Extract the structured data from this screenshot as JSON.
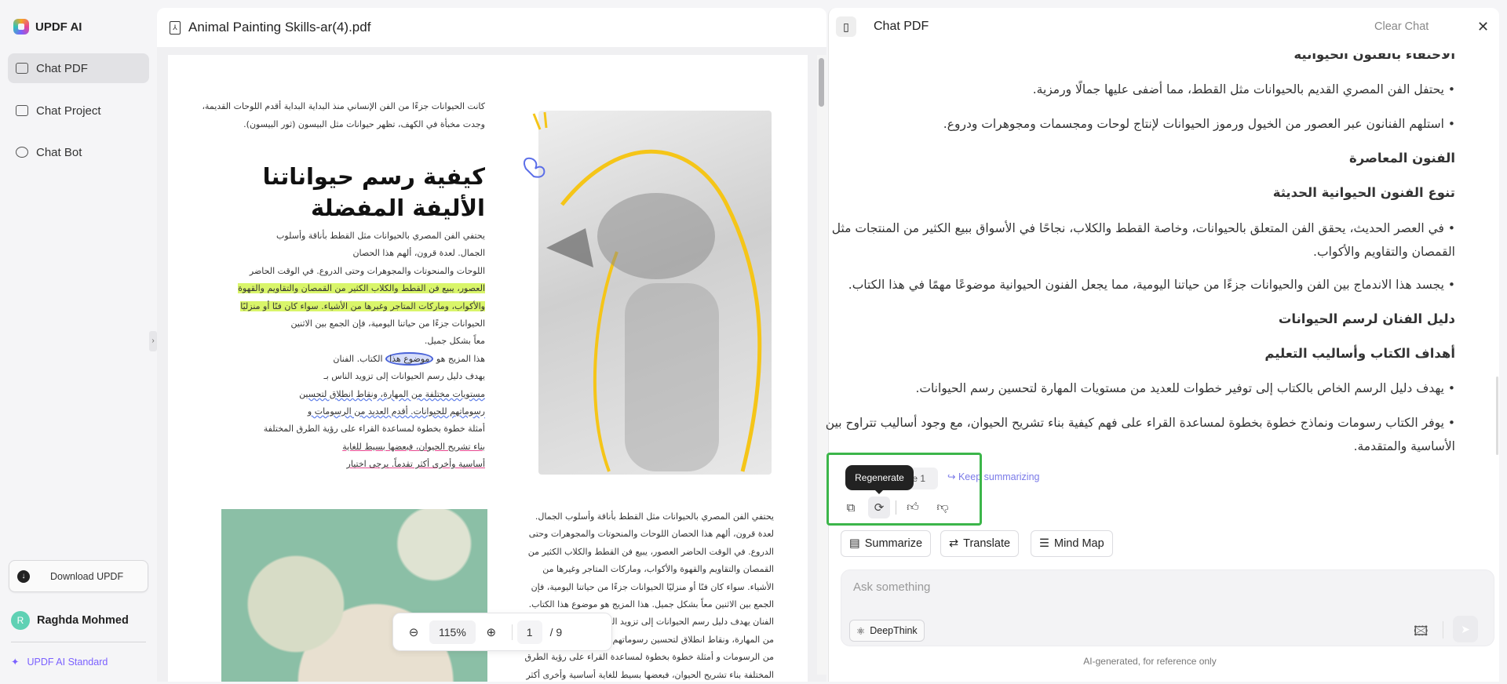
{
  "sidebar": {
    "app_name": "UPDF AI",
    "items": [
      {
        "label": "Chat PDF",
        "active": true
      },
      {
        "label": "Chat Project"
      },
      {
        "label": "Chat Bot"
      }
    ],
    "download_label": "Download UPDF",
    "user": {
      "initial": "R",
      "name": "Raghda Mohmed"
    },
    "plan_label": "UPDF AI Standard"
  },
  "viewer": {
    "file_name": "Animal Painting Skills-ar(4).pdf",
    "zoom": "115%",
    "page_current": "1",
    "page_total": "/ 9",
    "intro": [
      "كانت الحيوانات جزءًا من الفن الإنساني منذ البداية البداية أقدم اللوحات القديمة،",
      "وجدت مخبأة في الكهف، تظهر حيوانات مثل البيسون (ثور البيسون)."
    ],
    "title": "كيفية رسم حيواناتنا الأليفة المفضلة",
    "para": [
      "يحتفي الفن المصري بالحيوانات مثل القطط بأناقة وأسلوب",
      "الجمال. لعدة قرون، ألهم هذا الحصان",
      "اللوحات والمنحوتات والمجوهرات وحتى الدروع. في الوقت الحاضر",
      "العصور، يبيع فن القطط والكلاب الكثير من القمصان والتقاويم والقهوة",
      "والأكواب، وماركات المتاجر وغيرها من الأشياء. سواء كان فنًا أو منزليًا",
      "الحيوانات جزءًا من حياتنا اليومية، فإن الجمع بين الاثنين",
      "معاً بشكل جميل.",
      "هذا المزيج هو",
      "موضوع هذا",
      "الكتاب. الفنان",
      "يهدف دليل رسم الحيوانات إلى تزويد الناس بـ",
      "مستويات مختلفة من المهارة، ونقاط انطلاق لتحسين",
      "رسوماتهم للحيوانات. أقدم العديد من الرسومات و",
      "أمثلة خطوة بخطوة لمساعدة القراء على رؤية الطرق المختلفة",
      "بناء تشريح الحيوان، فبعضها بسيط للغاية",
      "أساسية وأخرى أكثر تقدماً. يرجى اختيار"
    ],
    "para2": [
      "يحتفي الفن المصري بالحيوانات مثل القطط بأناقة وأسلوب الجمال.",
      "لعدة قرون، ألهم هذا الحصان اللوحات والمنحوتات والمجوهرات وحتى",
      "الدروع. في الوقت الحاضر العصور، يبيع فن القطط والكلاب الكثير من",
      "القمصان والتقاويم والقهوة والأكواب، وماركات المتاجر وغيرها من",
      "الأشياء. سواء كان فنًا أو منزليًا الحيوانات جزءًا من حياتنا اليومية، فإن",
      "الجمع بين الاثنين معاً بشكل جميل. هذا المزيج هو موضوع هذا الكتاب.",
      "الفنان يهدف دليل رسم الحيوانات إلى تزويد الناس بـ",
      "من المهارة، ونقاط انطلاق لتحسين رسوماتهم للحيوانات",
      "من الرسومات و أمثلة خطوة بخطوة لمساعدة القراء على رؤية الطرق",
      "المختلفة بناء تشريح الحيوان، فبعضها بسيط للغاية أساسية وأخرى أكثر"
    ]
  },
  "chat": {
    "title": "Chat PDF",
    "clear_label": "Clear Chat",
    "lines": [
      {
        "text": "الاحتفاء بالفنون الحيوانية",
        "type": "h"
      },
      {
        "text": "• يحتفل الفن المصري القديم بالحيوانات مثل القطط، مما أضفى عليها جمالًا ورمزية.",
        "type": "p"
      },
      {
        "text": "• استلهم الفنانون عبر العصور من الخيول ورموز الحيوانات لإنتاج لوحات ومجسمات ومجوهرات ودروع.",
        "type": "p"
      },
      {
        "text": "الفنون المعاصرة",
        "type": "h"
      },
      {
        "text": "تنوع الفنون الحيوانية الحديثة",
        "type": "h"
      },
      {
        "text": "• في العصر الحديث، يحقق الفن المتعلق بالحيوانات، وخاصة القطط والكلاب، نجاحًا في الأسواق ببيع الكثير من المنتجات مثل",
        "type": "p"
      },
      {
        "text": "القمصان والتقاويم والأكواب.",
        "type": "p"
      },
      {
        "text": "• يجسد هذا الاندماج بين الفن والحيوانات جزءًا من حياتنا اليومية، مما يجعل الفنون الحيوانية موضوعًا مهمًا في هذا الكتاب.",
        "type": "p"
      },
      {
        "text": "دليل الفنان لرسم الحيوانات",
        "type": "h"
      },
      {
        "text": "أهداف الكتاب وأساليب التعليم",
        "type": "h"
      },
      {
        "text": "• يهدف دليل الرسم الخاص بالكتاب إلى توفير خطوات للعديد من مستويات المهارة لتحسين رسم الحيوانات.",
        "type": "p"
      },
      {
        "text": "• يوفر الكتاب رسومات ونماذج خطوة بخطوة لمساعدة القراء على فهم كيفية بناء تشريح الحيوان، مع وجود أساليب تتراوح بين",
        "type": "p"
      },
      {
        "text": "الأساسية والمتقدمة.",
        "type": "p"
      }
    ],
    "page_chip": "Page 1",
    "keep_label": "Keep summarizing",
    "tooltip": "Regenerate",
    "tools": [
      "Summarize",
      "Translate",
      "Mind Map"
    ],
    "input_placeholder": "Ask something",
    "deepthink_label": "DeepThink",
    "footer": "AI-generated, for reference only",
    "highlight_color": "#3cb64a"
  }
}
